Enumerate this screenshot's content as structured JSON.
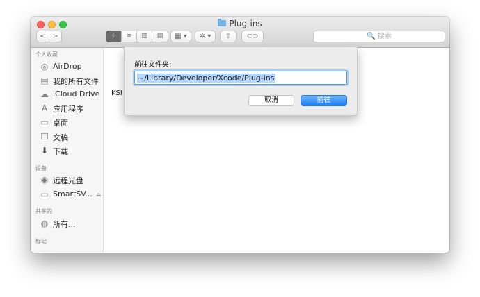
{
  "window": {
    "title": "Plug-ins"
  },
  "toolbar": {
    "back": "<",
    "forward": ">",
    "view_icon": "⁘",
    "view_list": "≡",
    "view_column": "▥",
    "view_coverflow": "▤",
    "arrange": "▦ ▾",
    "action": "✲ ▾",
    "share": "⇧",
    "tag": "⊂⊃"
  },
  "search": {
    "placeholder": "🔍 搜索"
  },
  "sidebar": {
    "favorites_header": "个人收藏",
    "favorites": [
      {
        "label": "AirDrop",
        "icon": "airdrop-icon",
        "glyph": "◎"
      },
      {
        "label": "我的所有文件",
        "icon": "all-files-icon",
        "glyph": "▤"
      },
      {
        "label": "iCloud Drive",
        "icon": "cloud-icon",
        "glyph": "☁"
      },
      {
        "label": "应用程序",
        "icon": "applications-icon",
        "glyph": "A"
      },
      {
        "label": "桌面",
        "icon": "desktop-icon",
        "glyph": "▭"
      },
      {
        "label": "文稿",
        "icon": "documents-icon",
        "glyph": "❐"
      },
      {
        "label": "下载",
        "icon": "downloads-icon",
        "glyph": "⬇"
      }
    ],
    "devices_header": "设备",
    "devices": [
      {
        "label": "远程光盘",
        "icon": "disc-icon",
        "glyph": "◉"
      },
      {
        "label": "SmartSV...",
        "icon": "drive-icon",
        "glyph": "▭",
        "eject": "⏏"
      }
    ],
    "shared_header": "共享的",
    "shared": [
      {
        "label": "所有...",
        "icon": "network-icon",
        "glyph": "◍"
      }
    ],
    "tags_header": "标记"
  },
  "content": {
    "partial_item": "KSI"
  },
  "goto_sheet": {
    "label": "前往文件夹:",
    "path_value": "~/Library/Developer/Xcode/Plug-ins",
    "cancel_label": "取消",
    "go_label": "前往"
  }
}
